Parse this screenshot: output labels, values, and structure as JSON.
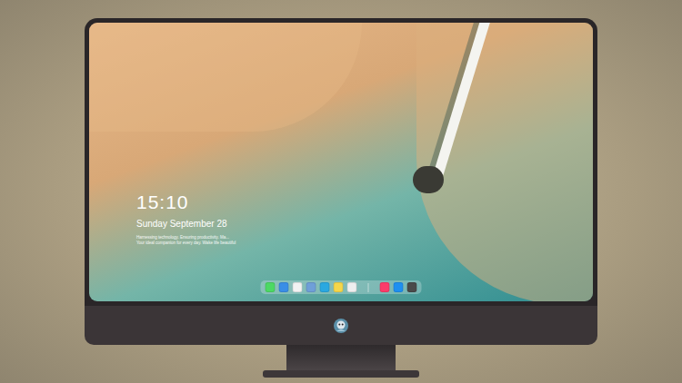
{
  "lock_screen": {
    "time": "15:10",
    "date": "Sunday September 28",
    "message": [
      "Harnessing technology. Ensuring productivity. Ma...",
      "Your ideal companion for every day. Wake life beautiful"
    ]
  },
  "dock": {
    "pinned": [
      {
        "color": "#4cd964"
      },
      {
        "color": "#3a8ee6"
      },
      {
        "color": "#f2f2f2"
      },
      {
        "color": "#6f9fd8"
      },
      {
        "color": "#2aa8e0"
      },
      {
        "color": "#f5d64a"
      },
      {
        "color": "#eeeeee"
      }
    ],
    "recent": [
      {
        "color": "#fc3c6a"
      },
      {
        "color": "#1e8ff0"
      },
      {
        "color": "#4a4a4a"
      }
    ]
  }
}
